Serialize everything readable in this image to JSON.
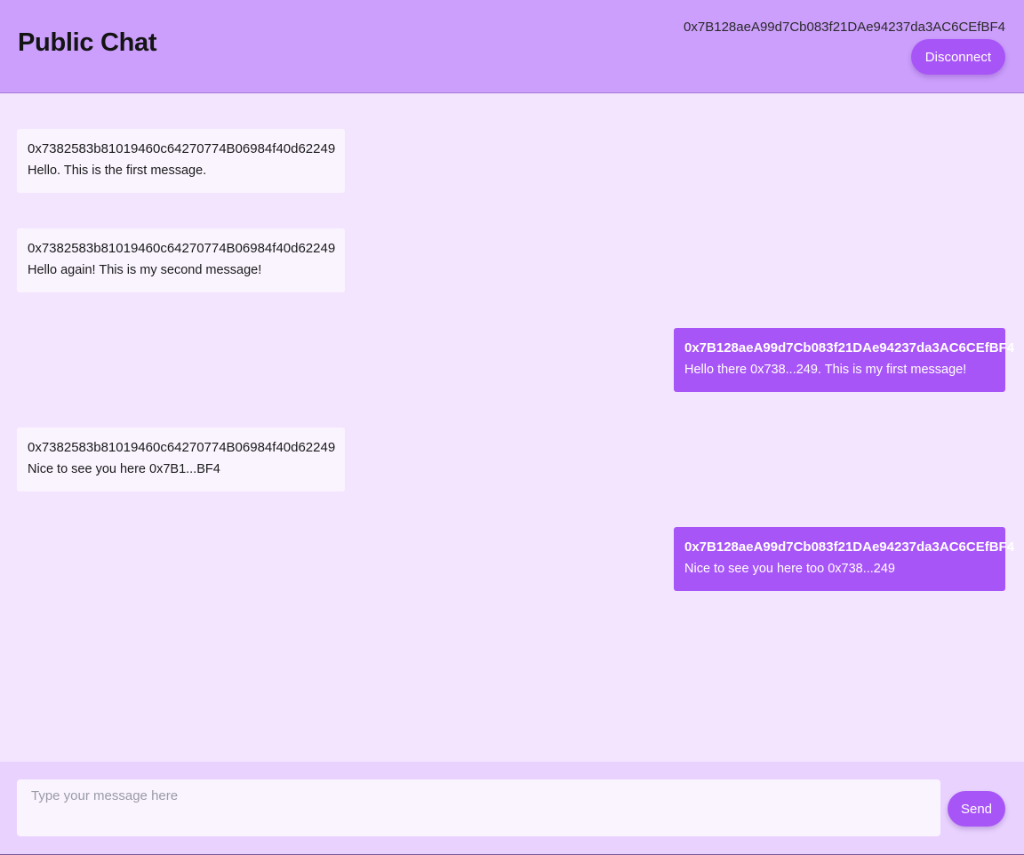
{
  "header": {
    "title": "Public Chat",
    "wallet_address": "0x7B128aeA99d7Cb083f21DAe94237da3AC6CEfBF4",
    "disconnect_label": "Disconnect"
  },
  "messages": [
    {
      "sender": "0x7382583b81019460c64270774B06984f40d62249",
      "text": "Hello. This is the first message.",
      "mine": false
    },
    {
      "sender": "0x7382583b81019460c64270774B06984f40d62249",
      "text": "Hello again! This is my second message!",
      "mine": false
    },
    {
      "sender": "0x7B128aeA99d7Cb083f21DAe94237da3AC6CEfBF4",
      "text": "Hello there 0x738...249. This is my first message!",
      "mine": true
    },
    {
      "sender": "0x7382583b81019460c64270774B06984f40d62249",
      "text": "Nice to see you here 0x7B1...BF4",
      "mine": false
    },
    {
      "sender": "0x7B128aeA99d7Cb083f21DAe94237da3AC6CEfBF4",
      "text": "Nice to see you here too 0x738...249",
      "mine": true
    }
  ],
  "composer": {
    "placeholder": "Type your message here",
    "send_label": "Send"
  },
  "colors": {
    "header_bg": "#cc9ffc",
    "page_bg": "#f3e5fe",
    "accent": "#a855f7",
    "bubble_other": "#faf4ff",
    "composer_bg": "#e9d3fe"
  }
}
